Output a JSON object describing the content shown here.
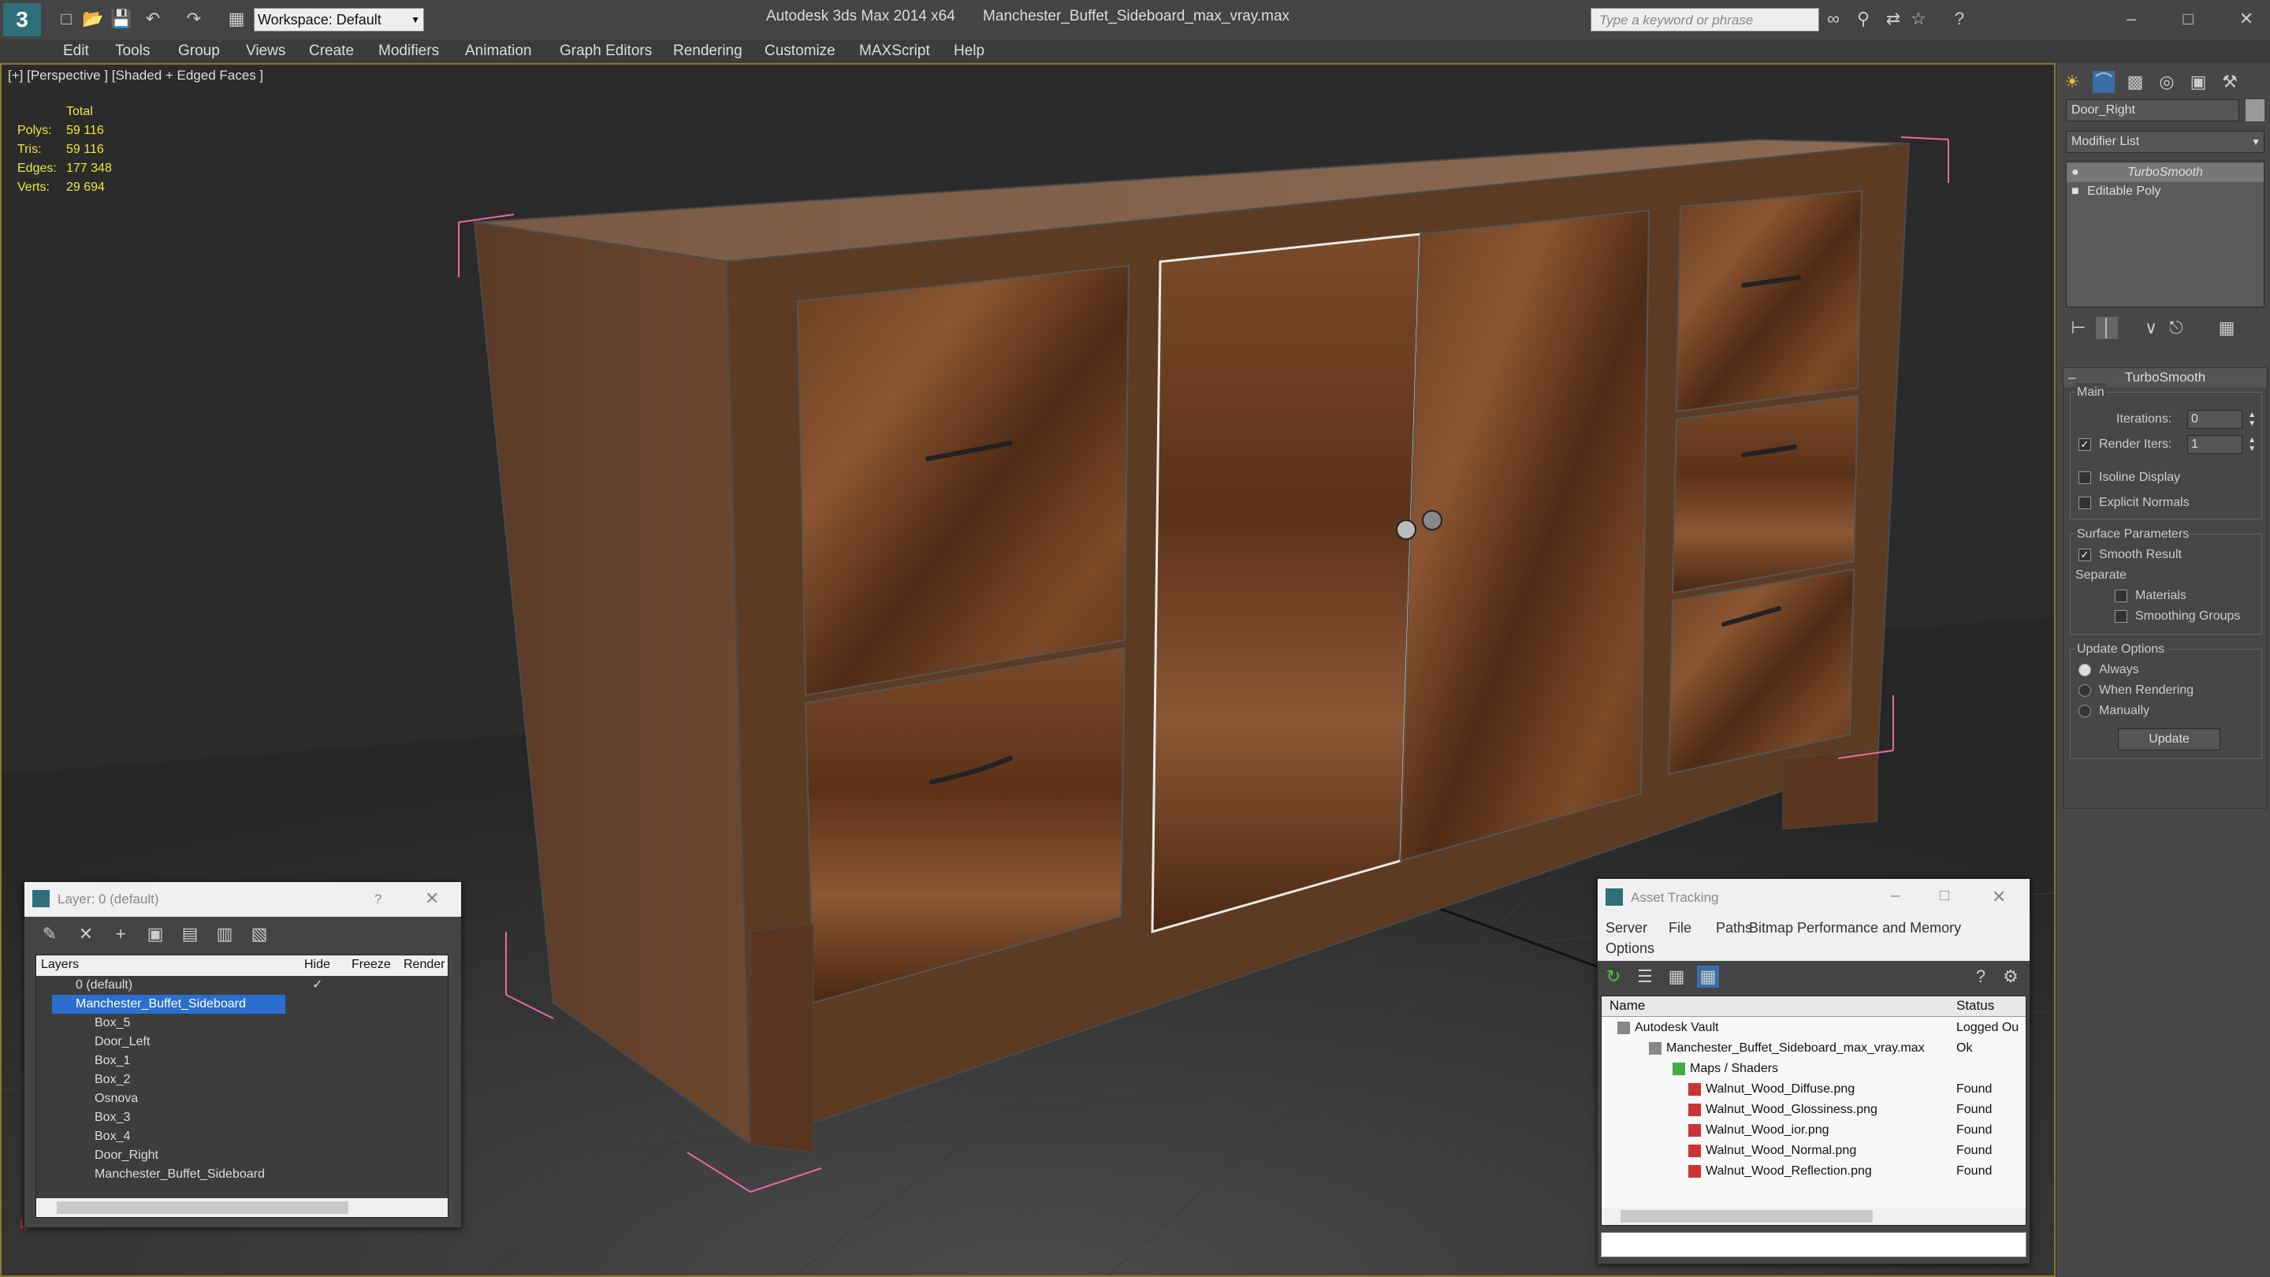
{
  "window": {
    "title": "Autodesk 3ds Max  2014 x64",
    "file": "Manchester_Buffet_Sideboard_max_vray.max",
    "workspace": "Workspace: Default",
    "search_placeholder": "Type a keyword or phrase"
  },
  "menu": [
    "Edit",
    "Tools",
    "Group",
    "Views",
    "Create",
    "Modifiers",
    "Animation",
    "Graph Editors",
    "Rendering",
    "Customize",
    "MAXScript",
    "Help"
  ],
  "viewport": {
    "label": "[+] [Perspective ] [Shaded + Edged Faces ]",
    "stats": {
      "header": "Total",
      "polys_label": "Polys:",
      "polys": "59 116",
      "tris_label": "Tris:",
      "tris": "59 116",
      "edges_label": "Edges:",
      "edges": "177 348",
      "verts_label": "Verts:",
      "verts": "29 694"
    }
  },
  "command_panel": {
    "object_name": "Door_Right",
    "modifier_list": "Modifier List",
    "stack": [
      "TurboSmooth",
      "Editable Poly"
    ],
    "rollout": {
      "title": "TurboSmooth",
      "main": "Main",
      "iterations_label": "Iterations:",
      "iterations": "0",
      "render_iters_label": "Render Iters:",
      "render_iters": "1",
      "isoline": "Isoline Display",
      "explicit": "Explicit Normals",
      "surface": "Surface Parameters",
      "smooth_result": "Smooth Result",
      "separate": "Separate",
      "materials": "Materials",
      "smoothing_groups": "Smoothing Groups",
      "update_options": "Update Options",
      "always": "Always",
      "when_rendering": "When Rendering",
      "manually": "Manually",
      "update_btn": "Update"
    }
  },
  "layer_panel": {
    "title": "Layer: 0 (default)",
    "help": "?",
    "columns": [
      "Layers",
      "Hide",
      "Freeze",
      "Render"
    ],
    "rows": [
      "0 (default)",
      "Manchester_Buffet_Sideboard",
      "Box_5",
      "Door_Left",
      "Box_1",
      "Box_2",
      "Osnova",
      "Box_3",
      "Box_4",
      "Door_Right",
      "Manchester_Buffet_Sideboard"
    ]
  },
  "asset_panel": {
    "title": "Asset Tracking",
    "menu": [
      "Server",
      "File",
      "Paths",
      "Bitmap Performance and Memory",
      "Options"
    ],
    "columns": [
      "Name",
      "Status"
    ],
    "rows": [
      {
        "name": "Autodesk Vault",
        "status": "Logged Ou"
      },
      {
        "name": "Manchester_Buffet_Sideboard_max_vray.max",
        "status": "Ok"
      },
      {
        "name": "Maps / Shaders",
        "status": ""
      },
      {
        "name": "Walnut_Wood_Diffuse.png",
        "status": "Found"
      },
      {
        "name": "Walnut_Wood_Glossiness.png",
        "status": "Found"
      },
      {
        "name": "Walnut_Wood_ior.png",
        "status": "Found"
      },
      {
        "name": "Walnut_Wood_Normal.png",
        "status": "Found"
      },
      {
        "name": "Walnut_Wood_Reflection.png",
        "status": "Found"
      }
    ]
  }
}
